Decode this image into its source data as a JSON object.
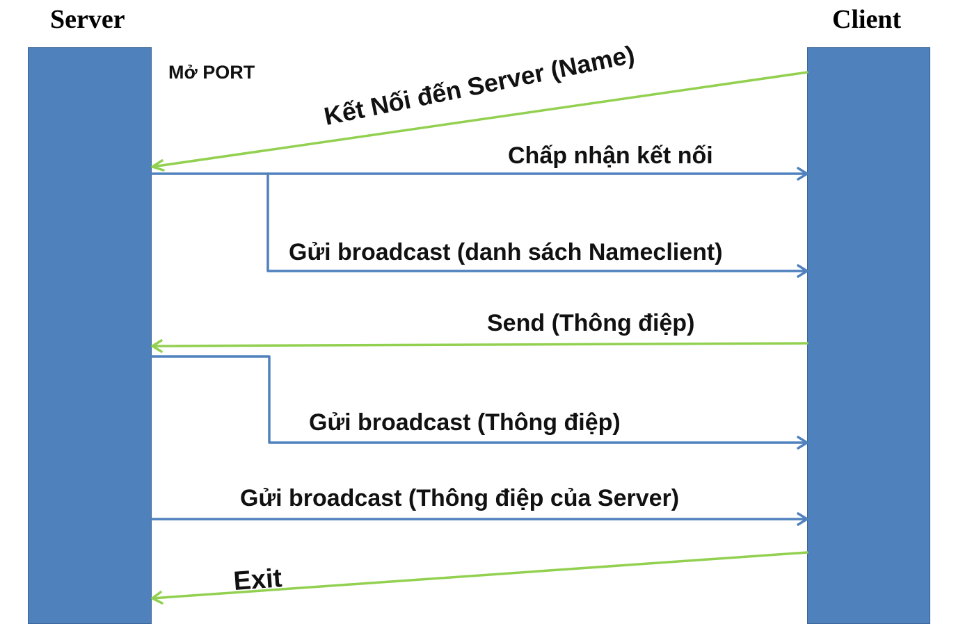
{
  "diagram": {
    "participants": {
      "server": "Server",
      "client": "Client"
    },
    "note": "Mở PORT",
    "messages": {
      "connect": "Kết Nối đến Server (Name)",
      "accept": "Chấp nhận kết nối",
      "broadcast_list": "Gửi broadcast (danh sách Nameclient)",
      "send": "Send (Thông điệp)",
      "broadcast_message": "Gửi broadcast (Thông điệp)",
      "broadcast_server": "Gửi broadcast (Thông điệp của Server)",
      "exit": "Exit"
    },
    "colors": {
      "lifeline": "#4f81bd",
      "client_to_server": "#92d050",
      "server_to_client": "#4f81bd"
    }
  }
}
